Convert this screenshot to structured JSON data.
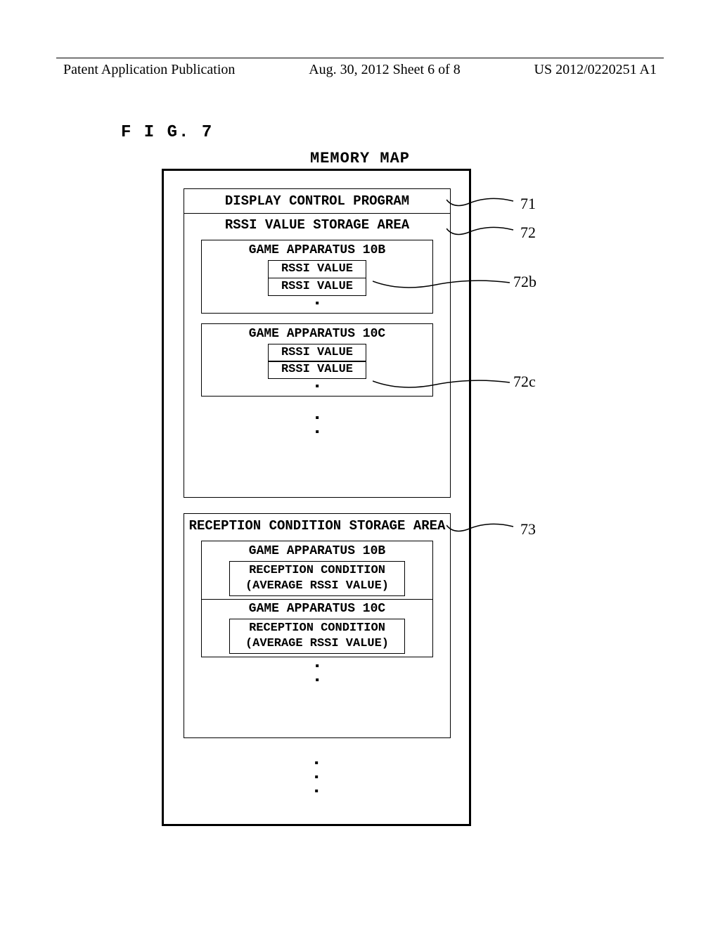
{
  "header": {
    "left": "Patent Application Publication",
    "center": "Aug. 30, 2012  Sheet 6 of 8",
    "right": "US 2012/0220251 A1"
  },
  "fig_label": "F I G.  7",
  "title": "MEMORY MAP",
  "row71": "DISPLAY CONTROL PROGRAM",
  "area72": {
    "title": "RSSI VALUE STORAGE AREA",
    "b": {
      "title": "GAME APPARATUS 10B",
      "v1": "RSSI VALUE",
      "v2": "RSSI VALUE"
    },
    "c": {
      "title": "GAME APPARATUS 10C",
      "v1": "RSSI VALUE",
      "v2": "RSSI VALUE"
    }
  },
  "area73": {
    "title": "RECEPTION CONDITION STORAGE AREA",
    "b": {
      "title": "GAME APPARATUS 10B",
      "l1": "RECEPTION CONDITION",
      "l2": "(AVERAGE RSSI VALUE)"
    },
    "c": {
      "title": "GAME APPARATUS 10C",
      "l1": "RECEPTION CONDITION",
      "l2": "(AVERAGE RSSI VALUE)"
    }
  },
  "refs": {
    "r71": "71",
    "r72": "72",
    "r72b": "72b",
    "r72c": "72c",
    "r73": "73"
  },
  "dots": {
    "one": "▪",
    "two": "▪",
    "three": "▪"
  }
}
